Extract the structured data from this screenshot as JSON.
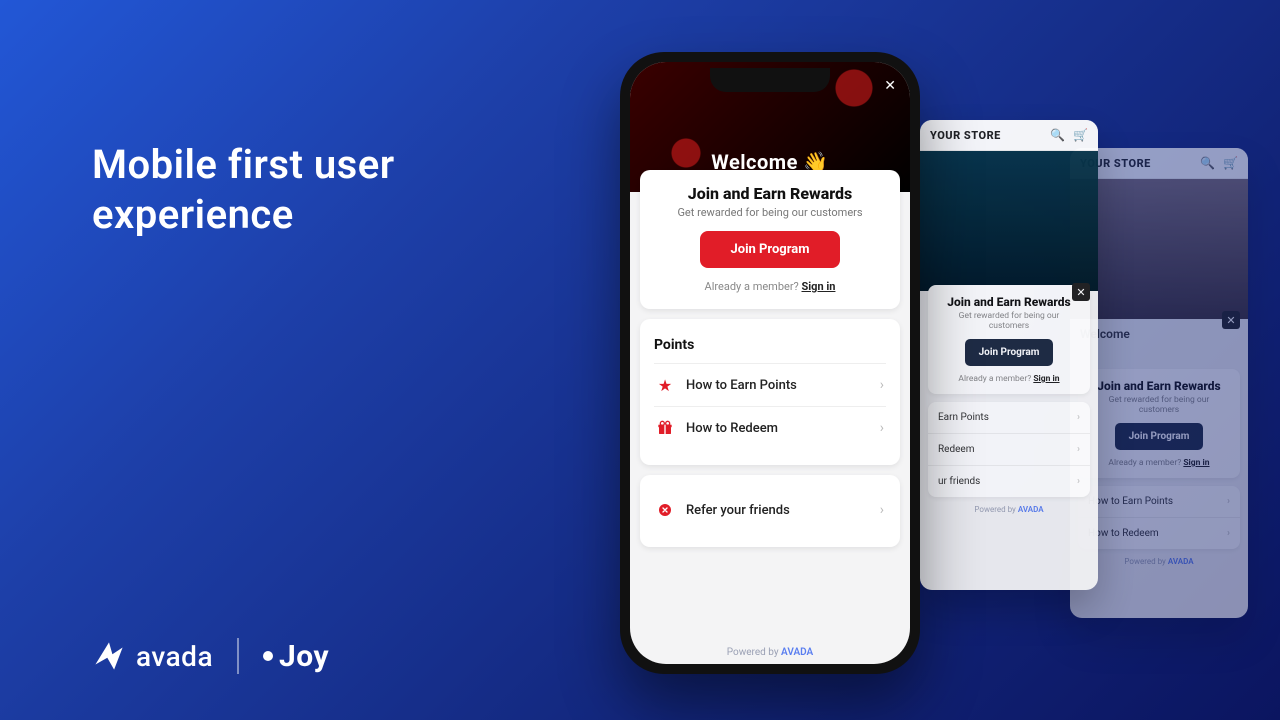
{
  "headline": "Mobile first user\nexperience",
  "logos": {
    "avada": "avada",
    "joy": "Joy"
  },
  "phone": {
    "welcome": "Welcome 👋",
    "join_title": "Join and Earn Rewards",
    "join_sub": "Get rewarded for being our customers",
    "join_btn": "Join Program",
    "already": "Already a member?",
    "signin": "Sign in",
    "points_title": "Points",
    "rows": [
      {
        "icon": "star",
        "label": "How to Earn Points"
      },
      {
        "icon": "gift",
        "label": "How to Redeem"
      }
    ],
    "refer_label": "Refer your friends",
    "powered": "Powered by",
    "brand": "AVADA"
  },
  "mini": {
    "store": "YOUR STORE",
    "join_title": "Join and Earn Rewards",
    "join_sub": "Get rewarded for being our customers",
    "join_btn": "Join Program",
    "already": "Already a member?",
    "signin": "Sign in",
    "welcome": "Welcome",
    "rows": [
      "How to Earn Points",
      "How to Redeem",
      "Refer your friends"
    ],
    "r0": "Earn Points",
    "r1": "Redeem",
    "r2": "ur friends",
    "powered": "Powered by",
    "brand": "AVADA"
  }
}
